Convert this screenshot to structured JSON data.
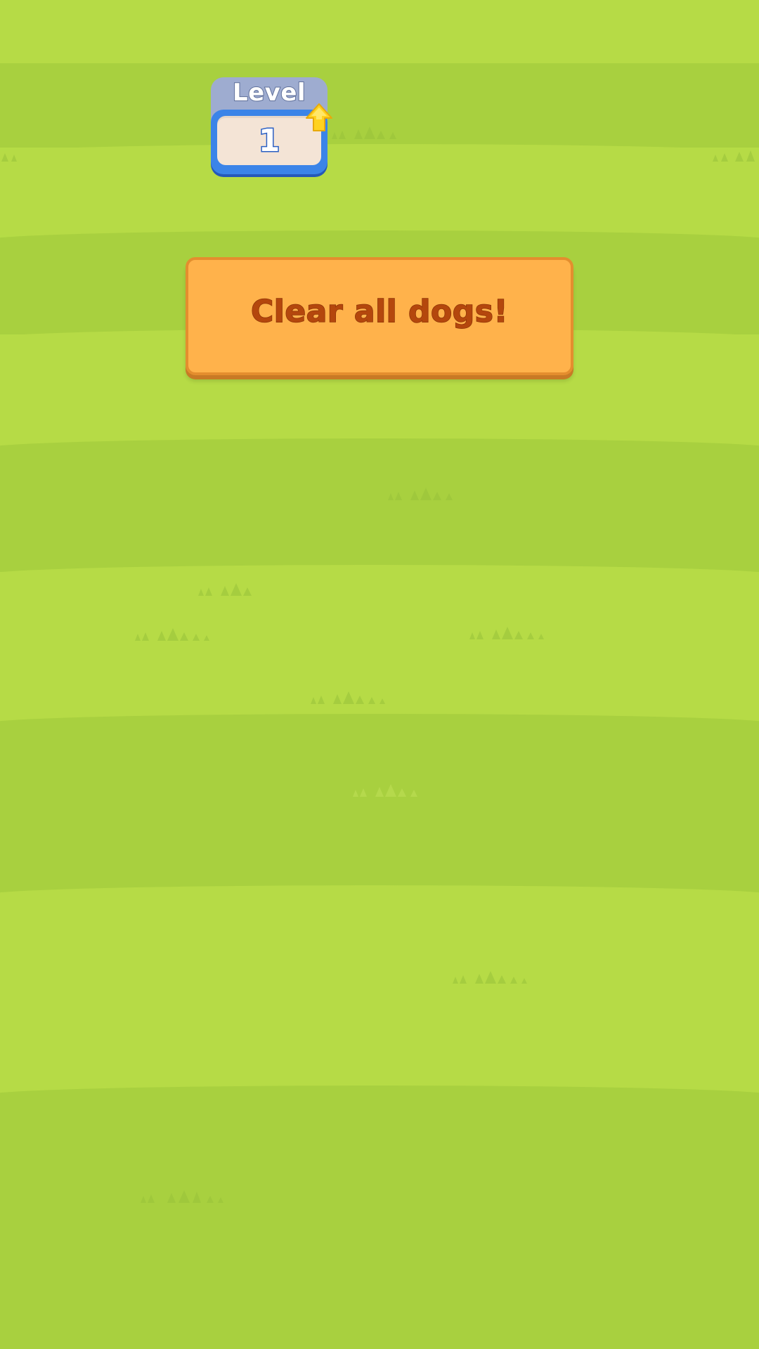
{
  "level": {
    "label": "Level",
    "number": "1",
    "level_up_icon": "arrow-up-icon",
    "colors": {
      "header": "#9eacd0",
      "frame": "#3b84e8",
      "inner": "#f4e4d6",
      "arrow": "#ffd21f"
    }
  },
  "objective": {
    "text": "Clear all dogs!",
    "colors": {
      "background": "#ffb24b",
      "text": "#b4470d"
    }
  },
  "background": {
    "light_grass": "#b6db46",
    "dark_grass": "#a8d03f",
    "decoration_icon": "grass-tuft-icon"
  }
}
